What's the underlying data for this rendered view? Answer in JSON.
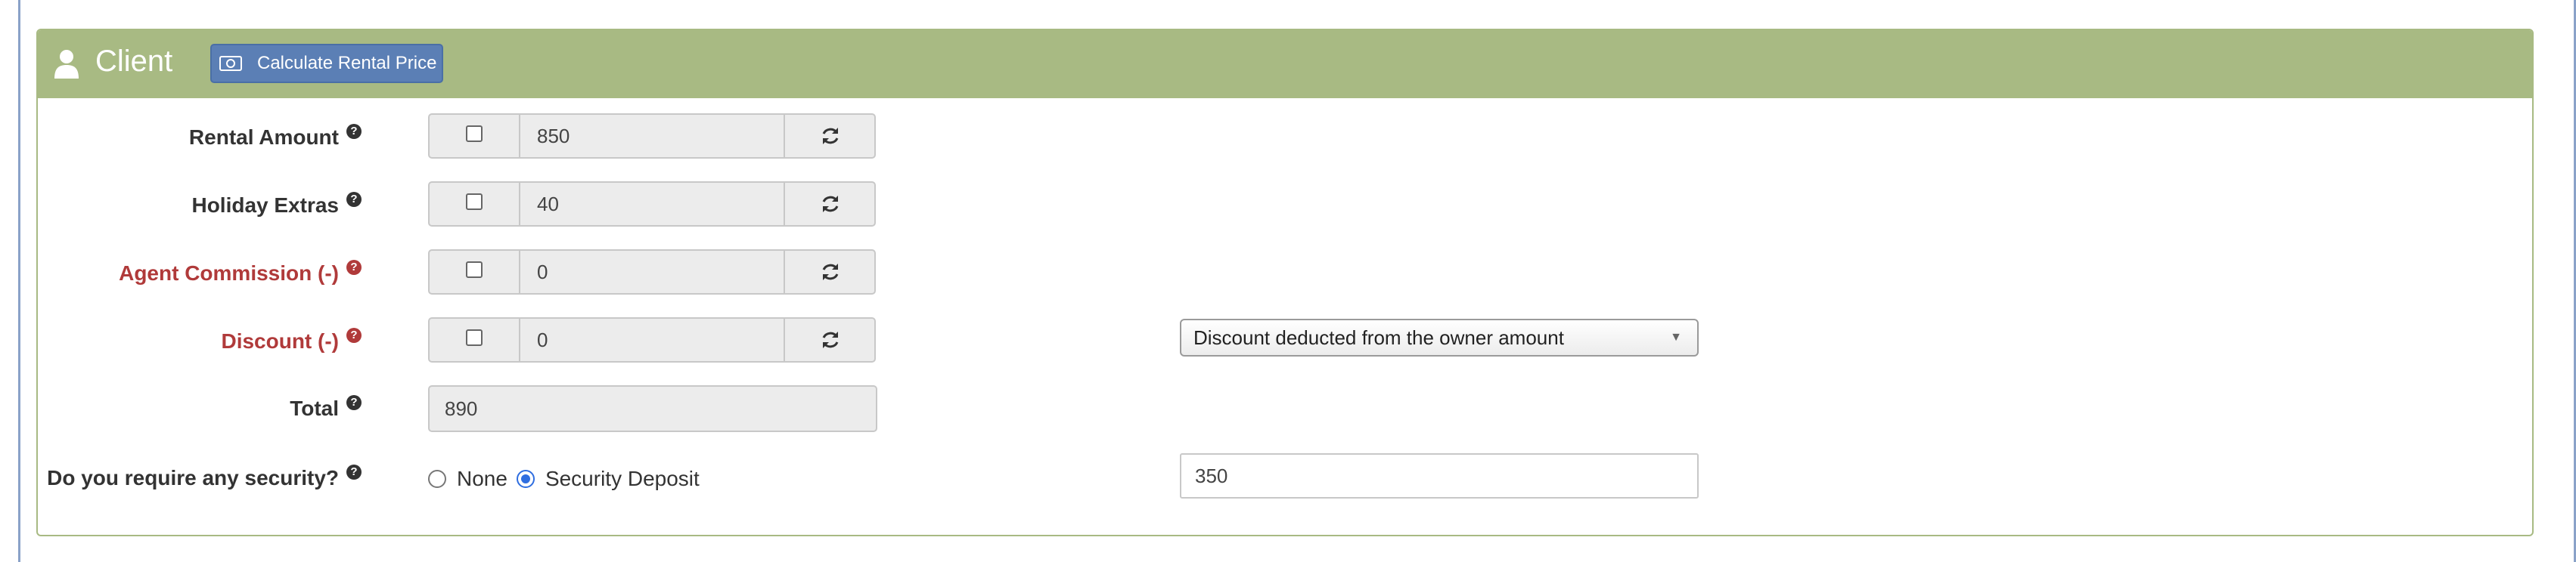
{
  "panel": {
    "title": "Client",
    "calculate_button_label": "Calculate Rental Price"
  },
  "fields": [
    {
      "label": "Rental Amount",
      "value": "850",
      "checked": false,
      "label_color": "#333333"
    },
    {
      "label": "Holiday Extras",
      "value": "40",
      "checked": false,
      "label_color": "#333333"
    },
    {
      "label": "Agent Commission (-)",
      "value": "0",
      "checked": false,
      "label_color": "#b03a3a"
    },
    {
      "label": "Discount (-)",
      "value": "0",
      "checked": false,
      "label_color": "#b03a3a"
    }
  ],
  "total": {
    "label": "Total",
    "value": "890"
  },
  "discount_select": {
    "selected": "Discount deducted from the owner amount"
  },
  "security": {
    "label": "Do you require any security?",
    "options": [
      {
        "label": "None",
        "selected": false
      },
      {
        "label": "Security Deposit",
        "selected": true
      }
    ],
    "deposit_value": "350"
  },
  "colors": {
    "header_bg": "#a8ba83",
    "button_bg": "#5b7fb5",
    "warning_label": "#b03a3a",
    "radio_selected": "#2f6ee0"
  }
}
